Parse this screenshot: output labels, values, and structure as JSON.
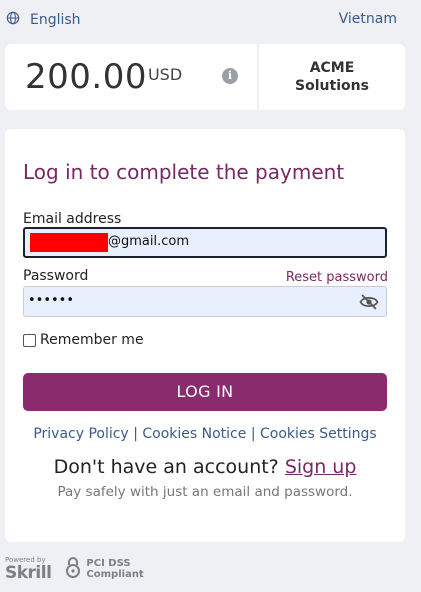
{
  "header": {
    "language": "English",
    "country": "Vietnam"
  },
  "payment": {
    "amount": "200.00",
    "currency": "USD",
    "merchant_line1": "ACME",
    "merchant_line2": "Solutions"
  },
  "login": {
    "title": "Log in to complete the payment",
    "email_label": "Email address",
    "email_value_visible": "@gmail.com",
    "password_label": "Password",
    "reset_password": "Reset password",
    "password_mask": "••••••",
    "remember_me": "Remember me",
    "login_button": "LOG IN",
    "privacy_policy": "Privacy Policy",
    "cookies_notice": "Cookies Notice",
    "cookies_settings": "Cookies Settings",
    "no_account": "Don't have an account?",
    "sign_up": "Sign up",
    "pay_safely": "Pay safely with just an email and password."
  },
  "footer": {
    "powered_by": "Powered by",
    "brand": "Skrill",
    "pci_line1": "PCI DSS",
    "pci_line2": "Compliant"
  },
  "colors": {
    "brand_purple": "#8a2b6e",
    "title_purple": "#7a2863",
    "link_blue": "#3a5a8a",
    "redaction": "#ff0000"
  }
}
